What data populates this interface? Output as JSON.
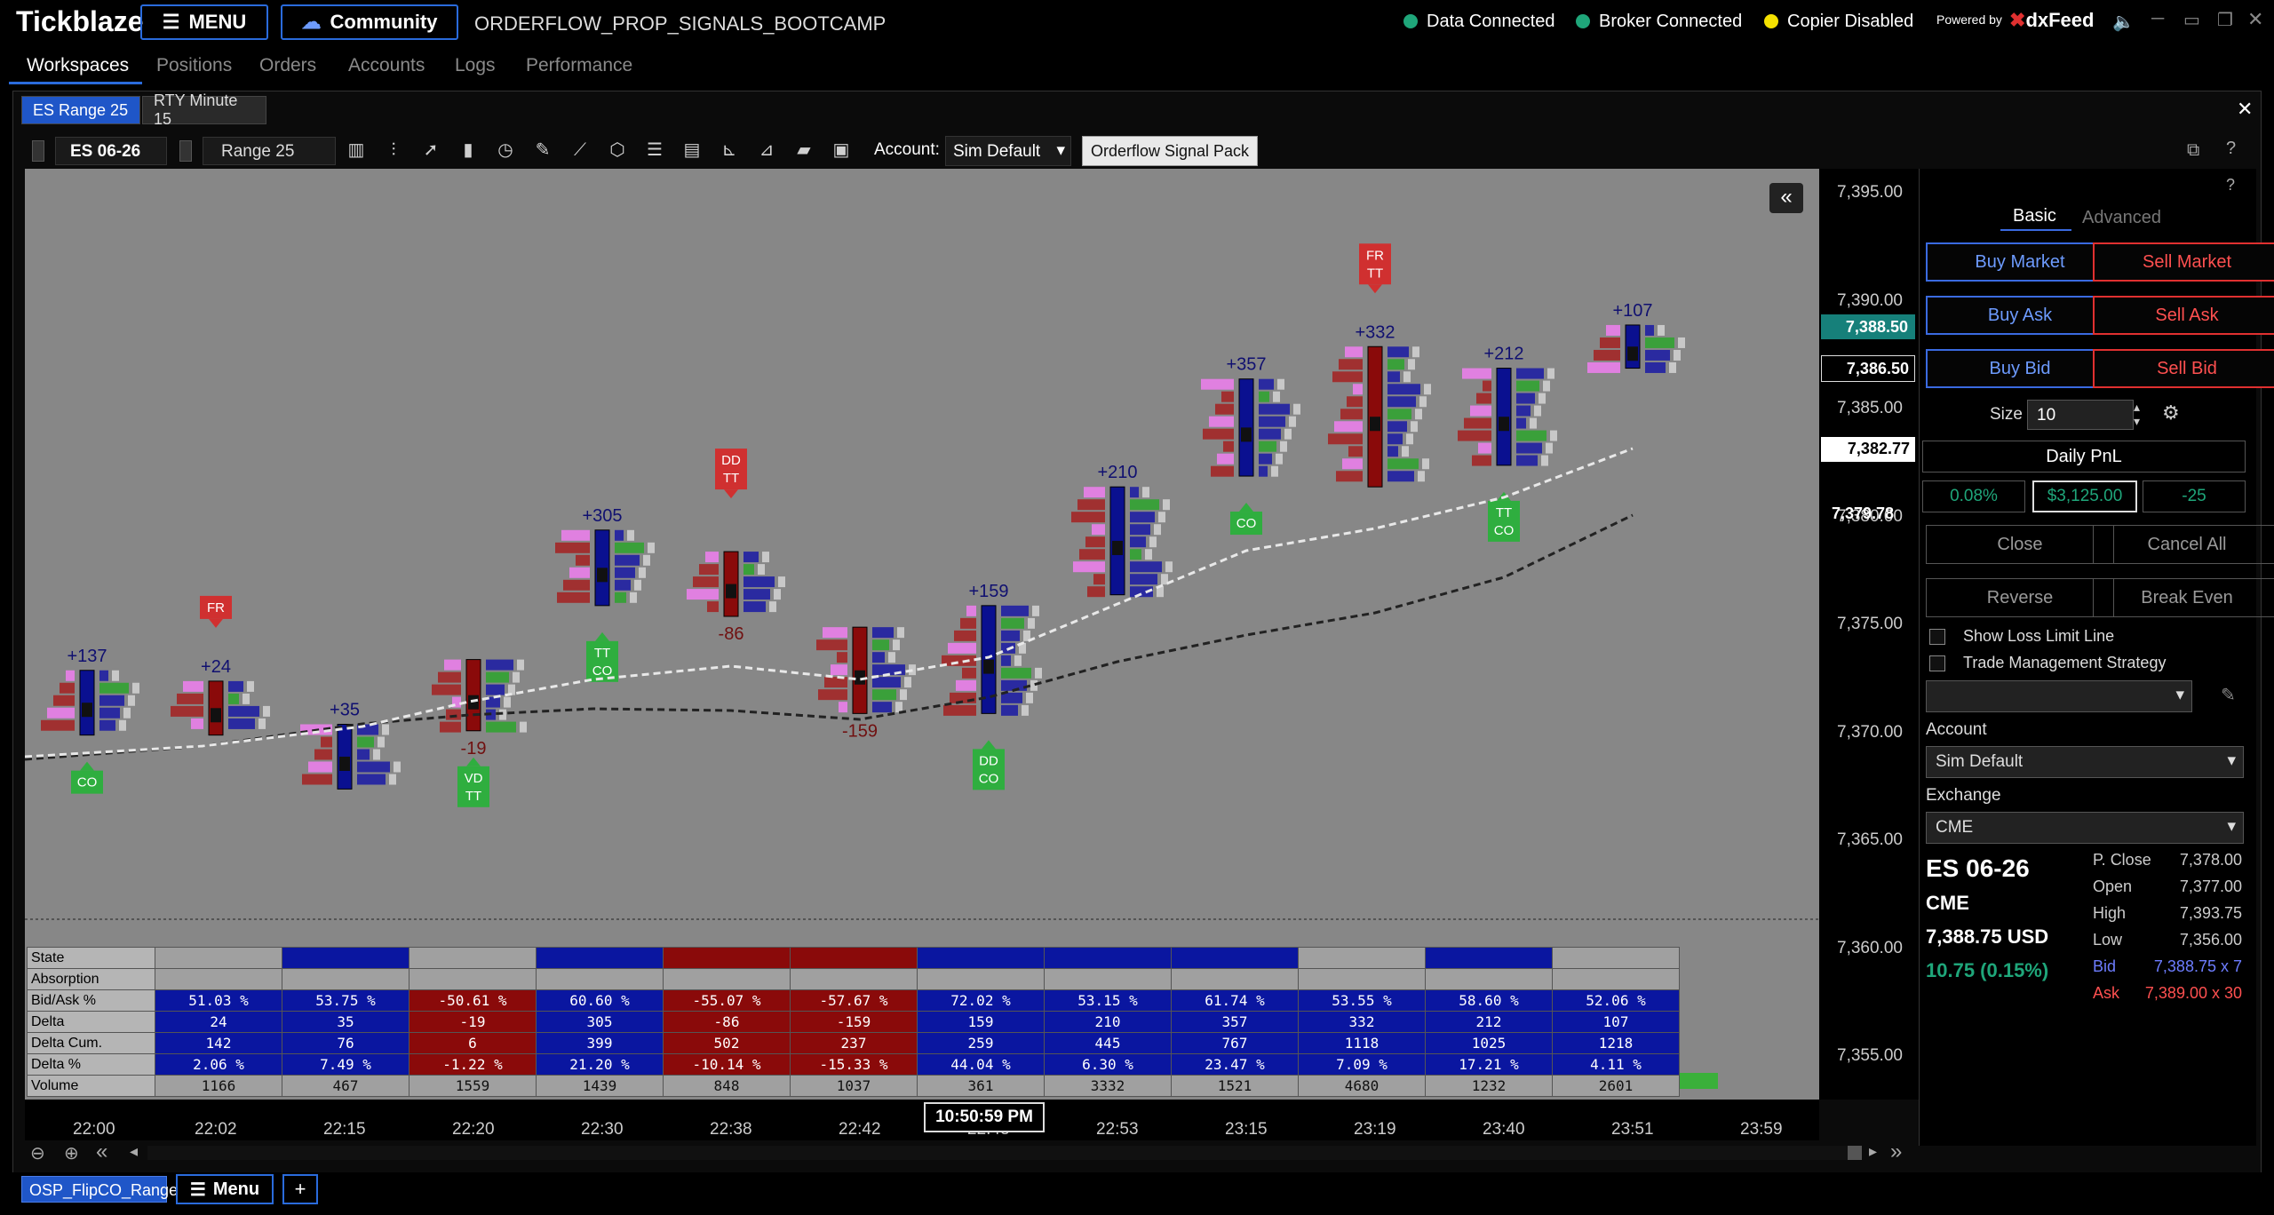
{
  "app": {
    "logo": "Tickblaze",
    "menu_label": "MENU",
    "community_label": "Community",
    "workspace_title": "ORDERFLOW_PROP_SIGNALS_BOOTCAMP"
  },
  "status": {
    "data": "Data Connected",
    "broker": "Broker Connected",
    "copier": "Copier Disabled",
    "powered_by": "Powered by",
    "provider": "dxFeed",
    "colors": {
      "data": "#1fa67a",
      "broker": "#1fa67a",
      "copier": "#f5e100"
    }
  },
  "nav": {
    "tabs": [
      "Workspaces",
      "Positions",
      "Orders",
      "Accounts",
      "Logs",
      "Performance"
    ],
    "active": "Workspaces"
  },
  "chart_tabs": [
    {
      "label": "ES Range 25",
      "active": true
    },
    {
      "label": "RTY Minute 15",
      "active": false
    }
  ],
  "toolbar": {
    "symbol": "ES 06-26",
    "bar_type": "Range 25",
    "account_label": "Account:",
    "account": "Sim Default",
    "signal_pack": "Orderflow Signal Pack"
  },
  "price_scale": {
    "labels": [
      "7,395.00",
      "7,390.00",
      "7,385.00",
      "7,380.00",
      "7,375.00",
      "7,370.00",
      "7,365.00",
      "7,360.00",
      "7,355.00"
    ],
    "last_price": "7,388.50",
    "marker1": "7,386.50",
    "marker2": "7,382.77",
    "marker3": "7,379.78"
  },
  "time_axis": {
    "labels": [
      "22:00",
      "22:02",
      "22:15",
      "22:20",
      "22:30",
      "22:38",
      "22:42",
      "22:48",
      "22:53",
      "23:15",
      "23:19",
      "23:40",
      "23:51",
      "23:59"
    ],
    "cursor_time": "10:50:59 PM"
  },
  "bars": [
    {
      "delta": "+137",
      "signal_below": [
        "CO"
      ]
    },
    {
      "delta": "+24",
      "signal_above": [
        "FR"
      ]
    },
    {
      "delta": "+35"
    },
    {
      "delta": "-19",
      "signal_below": [
        "VD",
        "TT"
      ]
    },
    {
      "delta": "+305",
      "signal_below": [
        "TT",
        "CO"
      ]
    },
    {
      "delta": "-86",
      "signal_above": [
        "DD",
        "TT"
      ]
    },
    {
      "delta": "-159"
    },
    {
      "delta": "+159",
      "signal_below": [
        "DD",
        "CO"
      ]
    },
    {
      "delta": "+210"
    },
    {
      "delta": "+357",
      "signal_below": [
        "CO"
      ]
    },
    {
      "delta": "+332",
      "signal_above": [
        "FR",
        "TT"
      ]
    },
    {
      "delta": "+212",
      "signal_below": [
        "TT",
        "CO"
      ]
    },
    {
      "delta": "+107"
    }
  ],
  "indicator_table": {
    "row_labels": [
      "State",
      "Absorption",
      "Bid/Ask %",
      "Delta",
      "Delta Cum.",
      "Delta %",
      "Volume"
    ],
    "bid_ask": [
      "51.03 %",
      "53.75 %",
      "-50.61 %",
      "60.60 %",
      "-55.07 %",
      "-57.67 %",
      "72.02 %",
      "53.15 %",
      "61.74 %",
      "53.55 %",
      "58.60 %",
      "52.06 %"
    ],
    "delta": [
      "24",
      "35",
      "-19",
      "305",
      "-86",
      "-159",
      "159",
      "210",
      "357",
      "332",
      "212",
      "107"
    ],
    "delta_cum": [
      "142",
      "76",
      "6",
      "399",
      "502",
      "237",
      "259",
      "445",
      "767",
      "1118",
      "1025",
      "1218"
    ],
    "delta_pct": [
      "2.06 %",
      "7.49 %",
      "-1.22 %",
      "21.20 %",
      "-10.14 %",
      "-15.33 %",
      "44.04 %",
      "6.30 %",
      "23.47 %",
      "7.09 %",
      "17.21 %",
      "4.11 %"
    ],
    "volume": [
      "1166",
      "467",
      "1559",
      "1439",
      "848",
      "1037",
      "361",
      "3332",
      "1521",
      "4680",
      "1232",
      "2601"
    ],
    "state_colors": [
      "#a0a0a0",
      "#0a16a0",
      "#a0a0a0",
      "#0a16a0",
      "#8a0a0a",
      "#8a0a0a",
      "#0a16a0",
      "#0a16a0",
      "#0a16a0",
      "#a0a0a0",
      "#0a16a0",
      "#a0a0a0"
    ]
  },
  "order_panel": {
    "tabs": [
      "Basic",
      "Advanced"
    ],
    "buy_market": "Buy Market",
    "sell_market": "Sell Market",
    "buy_ask": "Buy Ask",
    "sell_ask": "Sell Ask",
    "buy_bid": "Buy Bid",
    "sell_bid": "Sell Bid",
    "size_label": "Size",
    "size": "10",
    "daily_pnl": "Daily PnL",
    "pnl_pct": "0.08%",
    "pnl_usd": "$3,125.00",
    "pnl_ticks": "-25",
    "close": "Close",
    "cancel_all": "Cancel All",
    "reverse": "Reverse",
    "break_even": "Break Even",
    "show_loss_limit": "Show Loss Limit Line",
    "trade_mgmt": "Trade Management Strategy",
    "account_label": "Account",
    "account": "Sim Default",
    "exchange_label": "Exchange",
    "exchange": "CME"
  },
  "quote": {
    "symbol": "ES 06-26",
    "exchange": "CME",
    "price": "7,388.75 USD",
    "change": "10.75 (0.15%)",
    "stats": [
      {
        "label": "P. Close",
        "value": "7,378.00"
      },
      {
        "label": "Open",
        "value": "7,377.00"
      },
      {
        "label": "High",
        "value": "7,393.75"
      },
      {
        "label": "Low",
        "value": "7,356.00"
      },
      {
        "label": "Bid",
        "value": "7,388.75 x 7"
      },
      {
        "label": "Ask",
        "value": "7,389.00 x 30"
      }
    ]
  },
  "bottom": {
    "workspace_tab": "OSP_FlipCO_Range",
    "menu": "Menu",
    "add": "+"
  }
}
